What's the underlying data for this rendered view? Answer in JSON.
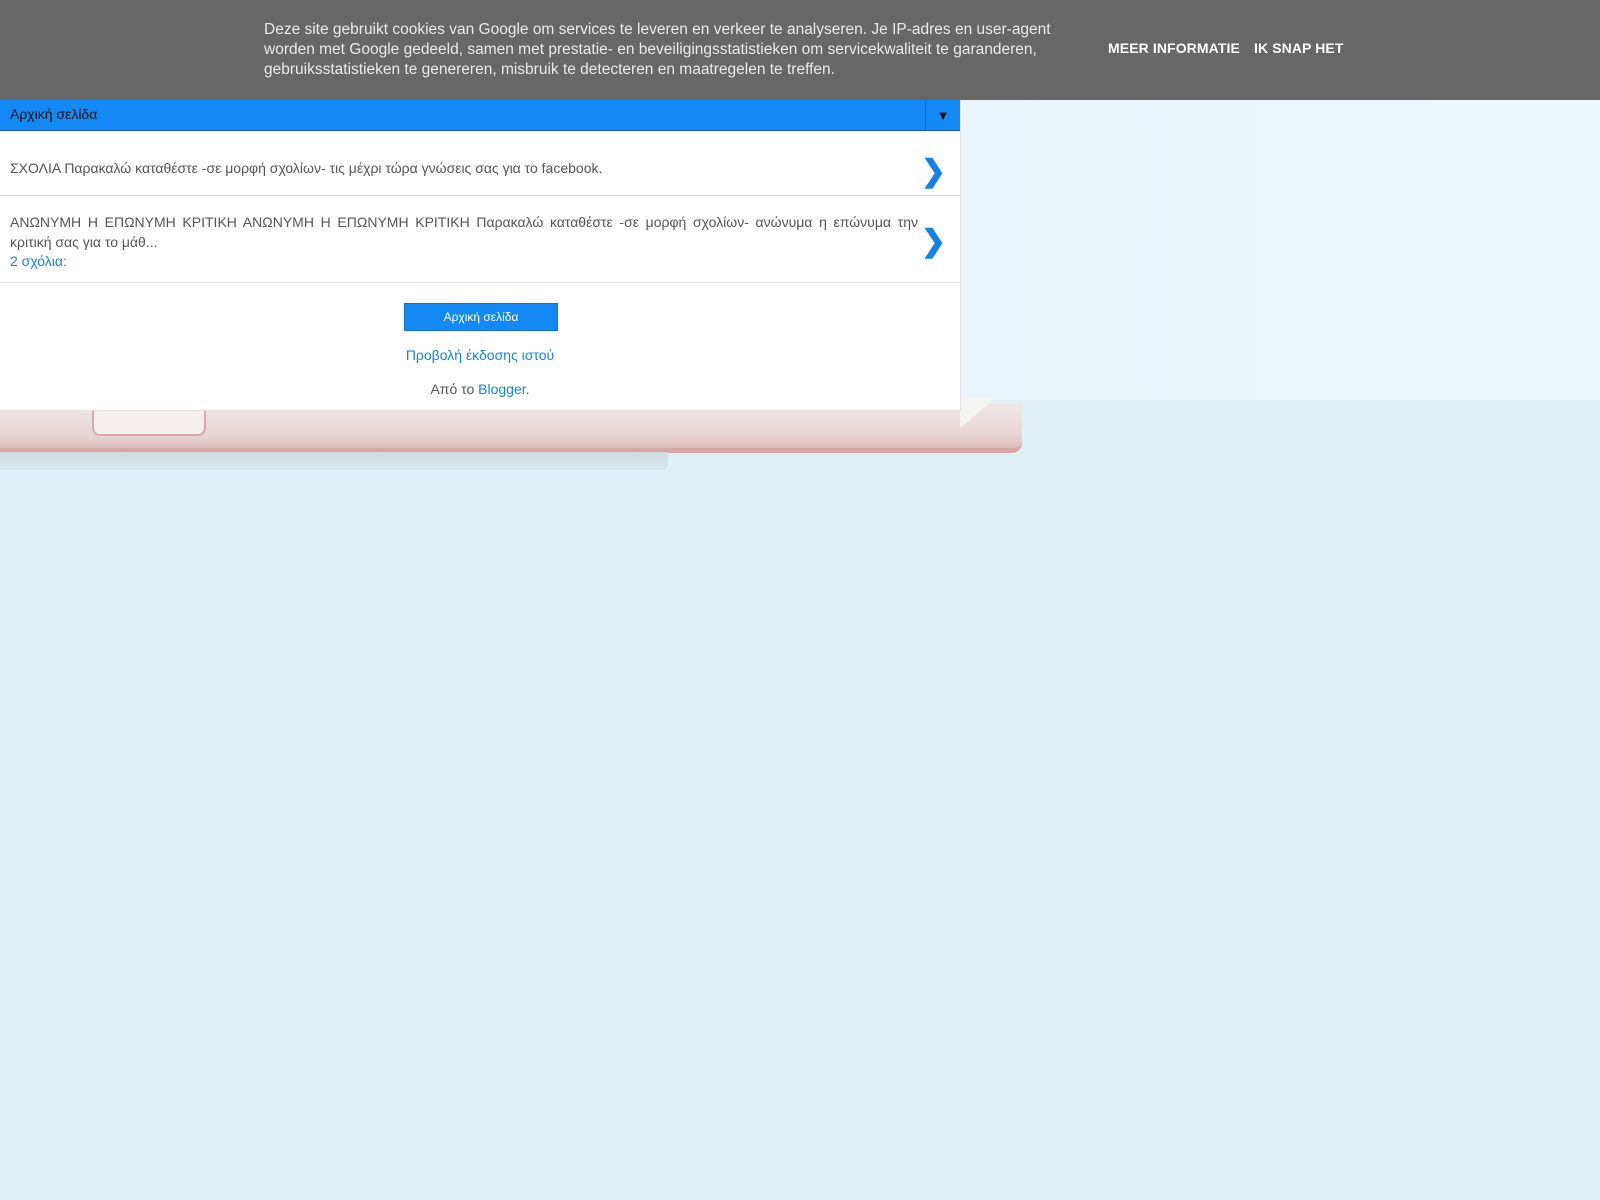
{
  "cookie_bar": {
    "text": "Deze site gebruikt cookies van Google om services te leveren en verkeer te analyseren. Je IP-adres en user-agent worden met Google gedeeld, samen met prestatie- en beveiligingsstatistieken om servicekwaliteit te garanderen, gebruiksstatistieken te genereren, misbruik te detecteren en maatregelen te treffen.",
    "more_info_label": "MEER INFORMATIE",
    "accept_label": "IK SNAP HET"
  },
  "nav": {
    "label": "Αρχική σελίδα",
    "toggle_glyph": "▼"
  },
  "posts": [
    {
      "snippet": "ΣΧΟΛΙΑ Παρακαλώ καταθέστε -σε μορφή σχολίων- τις μέχρι τώρα γνώσεις σας για το facebook.",
      "comments": "",
      "arrow": "❯"
    },
    {
      "snippet": "ΑΝΩΝΥΜΗ Η ΕΠΩΝΥΜΗ ΚΡΙΤΙΚΗ ΑΝΩΝΥΜΗ Η ΕΠΩΝΥΜΗ ΚΡΙΤΙΚΗ Παρακαλώ καταθέστε -σε μορφή σχολίων- ανώνυμα η επώνυμα την κριτική σας για το μάθ...",
      "comments": "2 σχόλια:",
      "arrow": "❯"
    }
  ],
  "footer": {
    "home_button_label": "Αρχική σελίδα",
    "web_version_label": "Προβολή έκδοσης ιστού",
    "powered_prefix": "Από το ",
    "powered_link": "Blogger",
    "powered_suffix": "."
  },
  "colors": {
    "accent": "#1289f5",
    "link": "#1283e6",
    "cookie_bar": "#676767",
    "page_background": "#dff0f7"
  }
}
